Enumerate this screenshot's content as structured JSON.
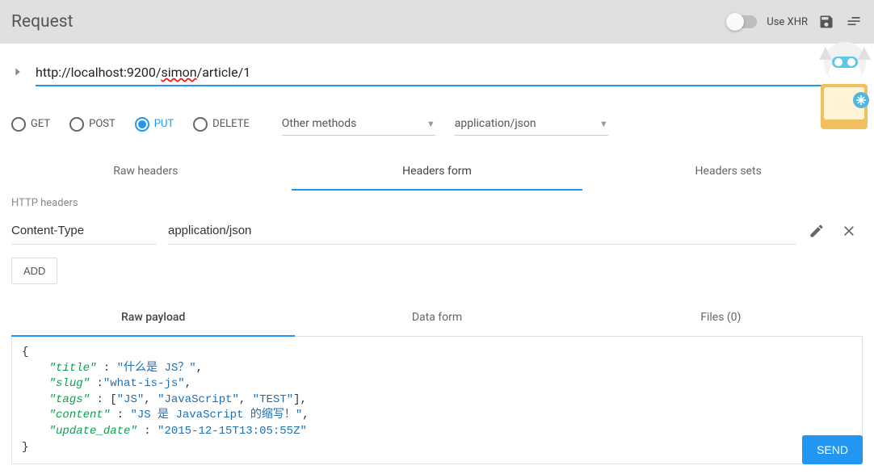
{
  "header": {
    "title": "Request",
    "use_xhr_label": "Use XHR"
  },
  "url": {
    "value": "http://localhost:9200/simon/article/1"
  },
  "methods": {
    "get": "GET",
    "post": "POST",
    "put": "PUT",
    "delete": "DELETE",
    "selected": "PUT",
    "other_label": "Other methods",
    "content_type": "application/json"
  },
  "header_tabs": {
    "raw": "Raw headers",
    "form": "Headers form",
    "sets": "Headers sets"
  },
  "http_headers": {
    "section_label": "HTTP headers",
    "rows": [
      {
        "name": "Content-Type",
        "value": "application/json"
      }
    ],
    "add_label": "ADD"
  },
  "payload_tabs": {
    "raw": "Raw payload",
    "data_form": "Data form",
    "files": "Files (0)"
  },
  "payload": {
    "lines": {
      "open": "{",
      "title_k": "\"title\"",
      "title_v": "\"什么是 JS？\"",
      "slug_k": "\"slug\"",
      "slug_v": "\"what-is-js\"",
      "tags_k": "\"tags\"",
      "tags_open": "[",
      "tags_v1": "\"JS\"",
      "tags_v2": "\"JavaScript\"",
      "tags_v3": "\"TEST\"",
      "tags_close": "]",
      "content_k": "\"content\"",
      "content_v": "\"JS 是 JavaScript 的缩写！\"",
      "update_k": "\"update_date\"",
      "update_v": "\"2015-12-15T13:05:55Z\"",
      "close": "}"
    }
  },
  "send_label": "SEND",
  "icons": {
    "save": "save-icon",
    "menu": "menu-icon",
    "chevron": "chevron-right-icon",
    "pencil": "pencil-icon",
    "close": "close-icon",
    "dropdown": "dropdown-icon"
  }
}
